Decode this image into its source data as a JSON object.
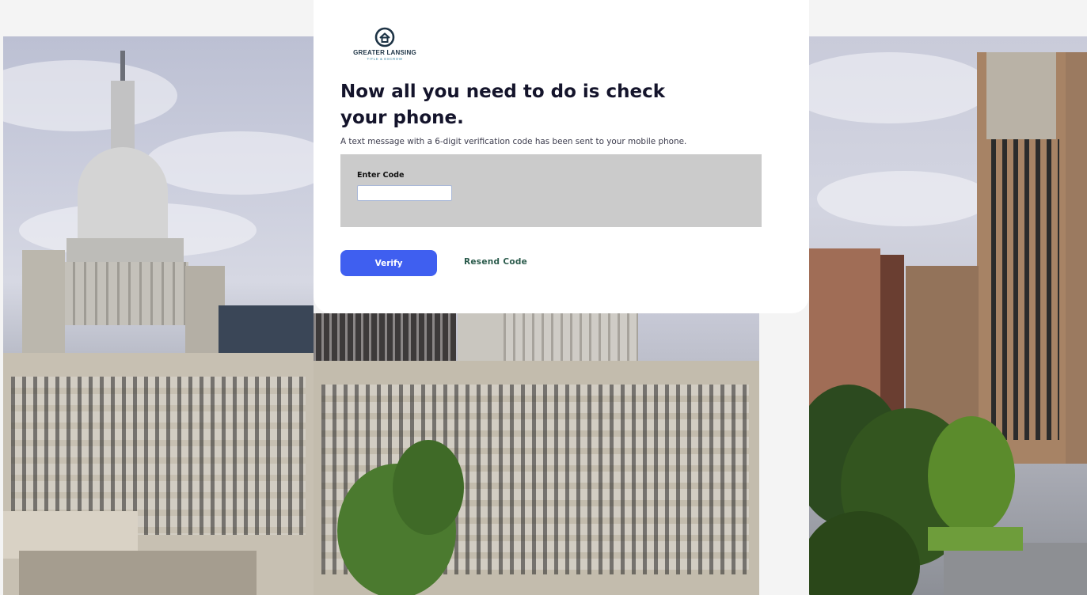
{
  "brand": {
    "name": "GREATER LANSING",
    "tagline": "TITLE & ESCROW",
    "logo_color": "#1d3345",
    "accent_color": "#4a8fa8"
  },
  "verification": {
    "heading": "Now all you need to do is check your phone.",
    "message": "A text message with a 6-digit verification code has been sent to your mobile phone.",
    "code_label": "Enter Code",
    "code_value": "",
    "code_placeholder": ""
  },
  "actions": {
    "verify_label": "Verify",
    "resend_label": "Resend Code",
    "primary_color": "#3f5ff0",
    "link_color": "#2b5b4c"
  },
  "background": {
    "description_icon": "city-skyline-photo"
  }
}
